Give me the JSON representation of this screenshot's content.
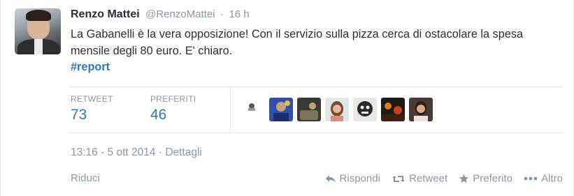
{
  "tweet": {
    "fullname": "Renzo Mattei",
    "username": "@RenzoMattei",
    "separator": "·",
    "time": "16 h",
    "text": "La Gabanelli è la vera opposizione! Con il servizio sulla pizza cerca di ostacolare la spesa mensile degli 80 euro. E' chiaro.",
    "hashtag": "#report",
    "colors": {
      "link": "#2b7bb9",
      "muted": "#8899a6",
      "text": "#292f33",
      "border": "#e1e8ed"
    }
  },
  "stats": {
    "retweet_label": "RETWEET",
    "retweet_count": "73",
    "favorites_label": "PREFERITI",
    "favorites_count": "46"
  },
  "favoriters": [
    "small-avatar",
    "avatar-1",
    "avatar-2",
    "avatar-3",
    "avatar-4",
    "avatar-5",
    "avatar-6"
  ],
  "details": {
    "timestamp": "13:16 - 5 ott 2014",
    "separator": "·",
    "details_link": "Dettagli"
  },
  "footer": {
    "collapse": "Riduci",
    "reply": "Rispondi",
    "retweet": "Retweet",
    "favorite": "Preferito",
    "more": "Altro",
    "icons": {
      "reply": "reply-icon",
      "retweet": "retweet-icon",
      "favorite": "star-icon",
      "more": "more-dots-icon"
    }
  }
}
